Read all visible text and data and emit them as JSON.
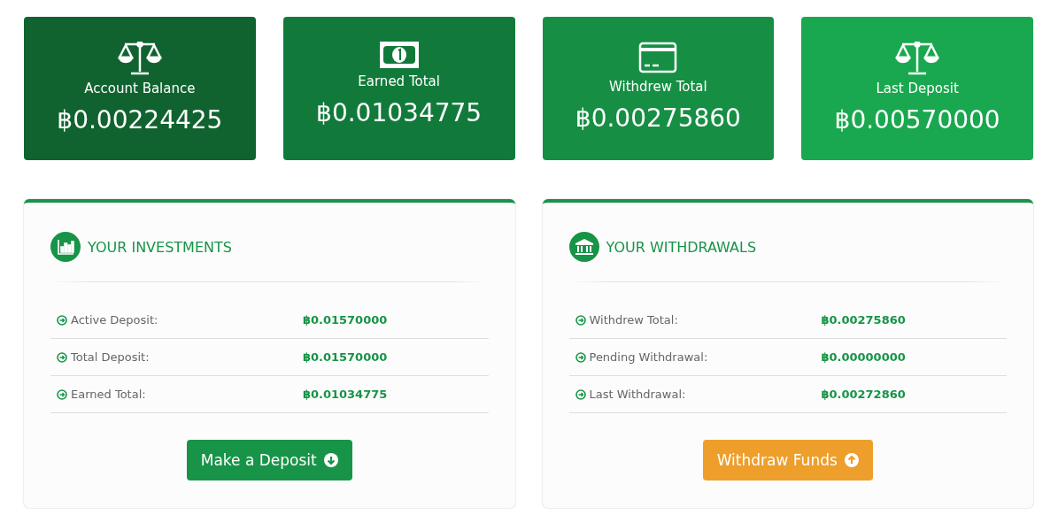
{
  "stats": [
    {
      "kind": "scale",
      "label": "Account Balance",
      "value": "฿0.00224425",
      "color": "#10632f"
    },
    {
      "kind": "money",
      "label": "Earned Total",
      "value": "฿0.01034775",
      "color": "#117a3b"
    },
    {
      "kind": "card",
      "label": "Withdrew Total",
      "value": "฿0.00275860",
      "color": "#168f44"
    },
    {
      "kind": "scale",
      "label": "Last Deposit",
      "value": "฿0.00570000",
      "color": "#19a84f"
    }
  ],
  "panels": [
    {
      "kind": "chart",
      "title": "YOUR INVESTMENTS",
      "rows": [
        {
          "label": "Active Deposit:",
          "value": "฿0.01570000"
        },
        {
          "label": "Total Deposit:",
          "value": "฿0.01570000"
        },
        {
          "label": "Earned Total:",
          "value": "฿0.01034775"
        }
      ],
      "button": {
        "kind": "down",
        "label": "Make a Deposit",
        "color": "#179447"
      }
    },
    {
      "kind": "bank",
      "title": "YOUR WITHDRAWALS",
      "rows": [
        {
          "label": "Withdrew Total:",
          "value": "฿0.00275860"
        },
        {
          "label": "Pending Withdrawal:",
          "value": "฿0.00000000"
        },
        {
          "label": "Last Withdrawal:",
          "value": "฿0.00272860"
        }
      ],
      "button": {
        "kind": "up",
        "label": "Withdraw Funds",
        "color": "#ee9e2a"
      }
    }
  ]
}
